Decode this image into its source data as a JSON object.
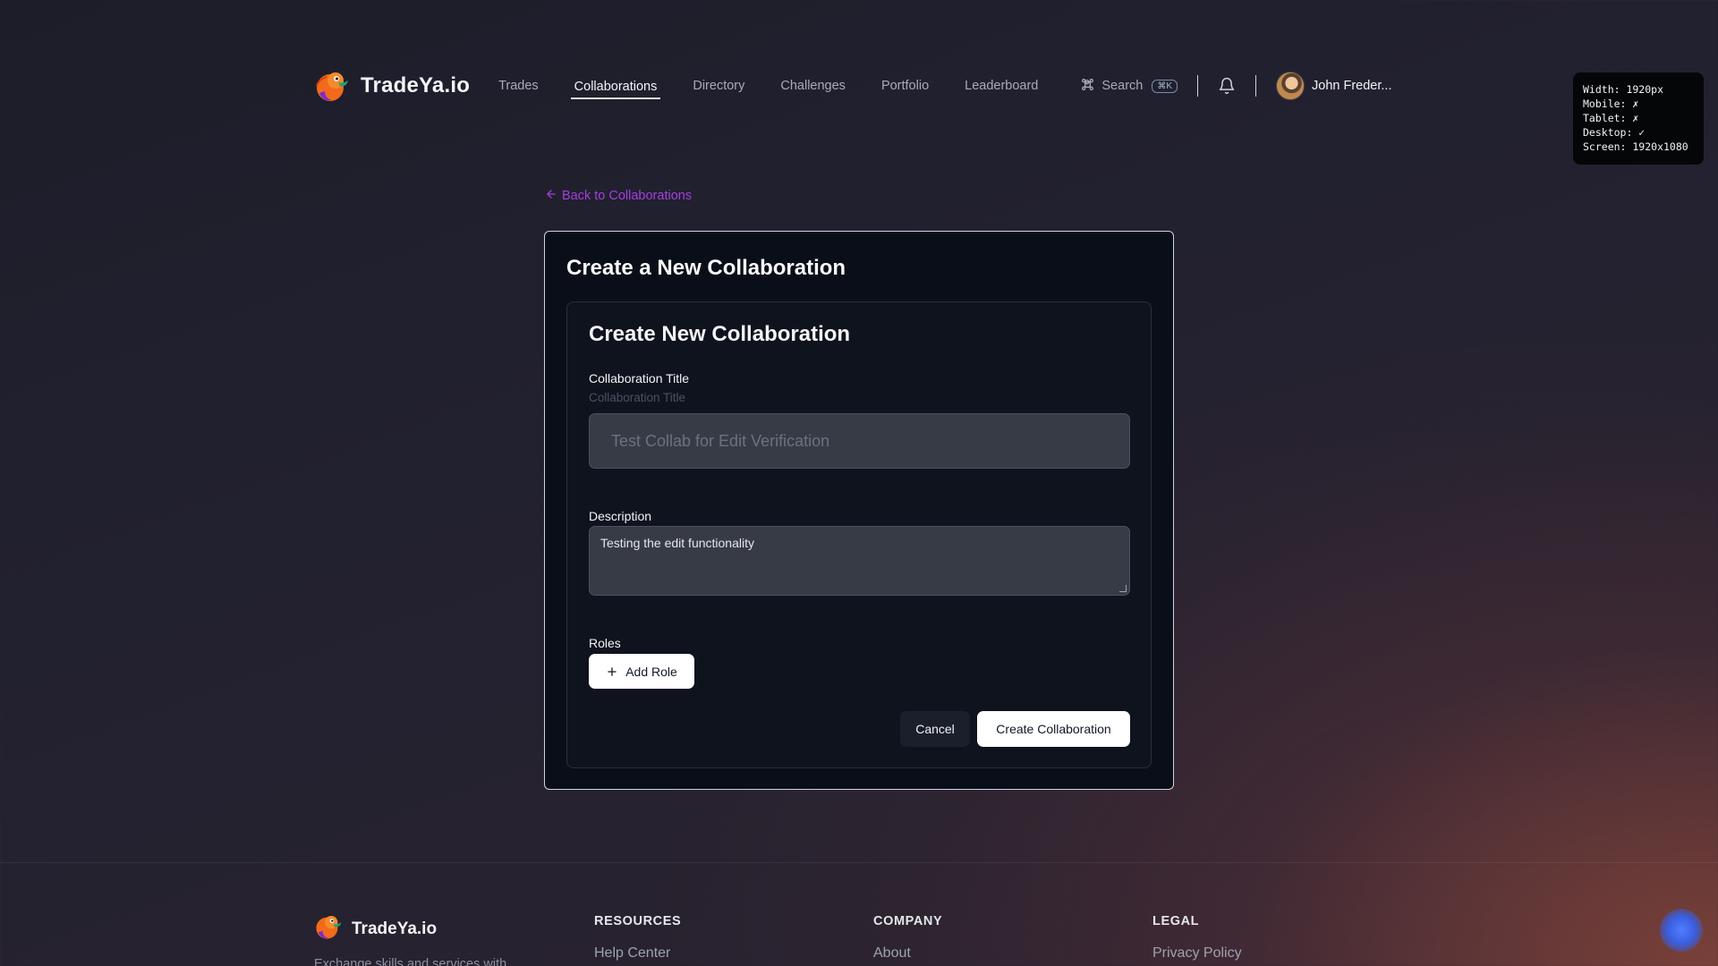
{
  "app": {
    "name": "TradeYa.io"
  },
  "nav": {
    "items": [
      {
        "label": "Trades"
      },
      {
        "label": "Collaborations"
      },
      {
        "label": "Directory"
      },
      {
        "label": "Challenges"
      },
      {
        "label": "Portfolio"
      },
      {
        "label": "Leaderboard"
      }
    ],
    "active": "Collaborations",
    "search_label": "Search",
    "search_shortcut": "⌘K",
    "user_name": "John Freder..."
  },
  "debug": {
    "text": "Width: 1920px\nMobile: ✗\nTablet: ✗\nDesktop: ✓\nScreen: 1920x1080"
  },
  "back_link": "Back to Collaborations",
  "page": {
    "title": "Create a New Collaboration"
  },
  "form": {
    "title": "Create New Collaboration",
    "title_label": "Collaboration Title",
    "title_hint": "Collaboration Title",
    "title_value": "Test Collab for Edit Verification",
    "description_label": "Description",
    "description_value": "Testing the edit functionality",
    "roles_label": "Roles",
    "add_role_label": "Add Role",
    "cancel_label": "Cancel",
    "submit_label": "Create Collaboration"
  },
  "footer": {
    "logo_text": "TradeYa.io",
    "tagline": "Exchange skills and services with",
    "columns": [
      {
        "heading": "RESOURCES",
        "first_link": "Help Center"
      },
      {
        "heading": "COMPANY",
        "first_link": "About"
      },
      {
        "heading": "LEGAL",
        "first_link": "Privacy Policy"
      }
    ]
  },
  "colors": {
    "accent_link": "#a73ee0",
    "card_bg": "#0a0e18",
    "input_bg": "#373b46"
  }
}
